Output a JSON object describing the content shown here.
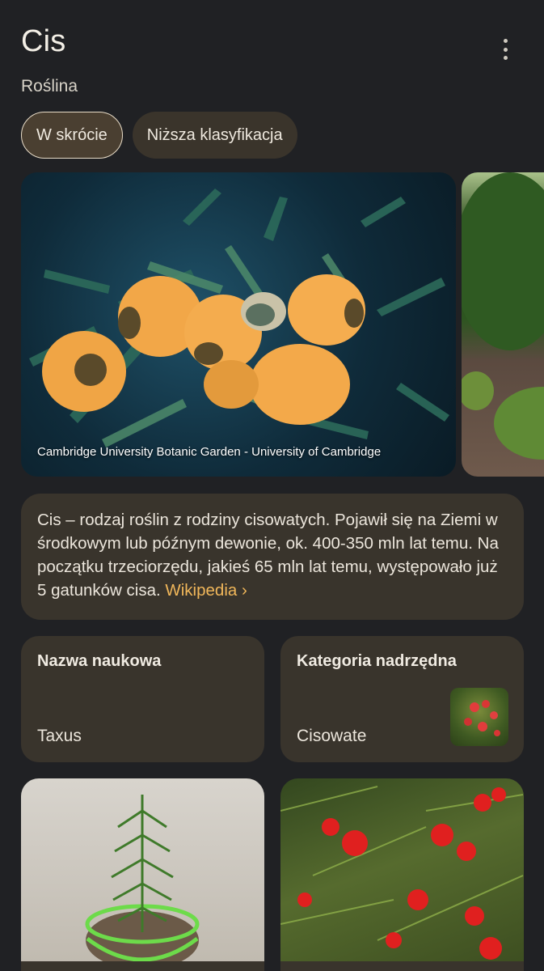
{
  "header": {
    "title": "Cis",
    "subtitle": "Roślina"
  },
  "tabs": [
    {
      "label": "W skrócie",
      "active": true
    },
    {
      "label": "Niższa klasyfikacja",
      "active": false
    }
  ],
  "images": {
    "main_caption": "Cambridge University Botanic Garden - University of Cambridge"
  },
  "description": {
    "text": "Cis – rodzaj roślin z rodziny cisowatych. Pojawił się na Ziemi w środkowym lub późnym dewonie, ok. 400-350 mln lat temu. Na początku trzeciorzędu, jakieś 65 mln lat temu, występowało już 5 gatunków cisa.",
    "source_label": "Wikipedia"
  },
  "facts": {
    "scientific_name": {
      "label": "Nazwa naukowa",
      "value": "Taxus"
    },
    "parent_category": {
      "label": "Kategoria nadrzędna",
      "value": "Cisowate"
    }
  },
  "colors": {
    "background": "#202124",
    "card": "#39342c",
    "accent_link": "#f1b75a"
  },
  "icons": {
    "menu": "more-vert-icon",
    "chevron": "chevron-right-icon"
  }
}
